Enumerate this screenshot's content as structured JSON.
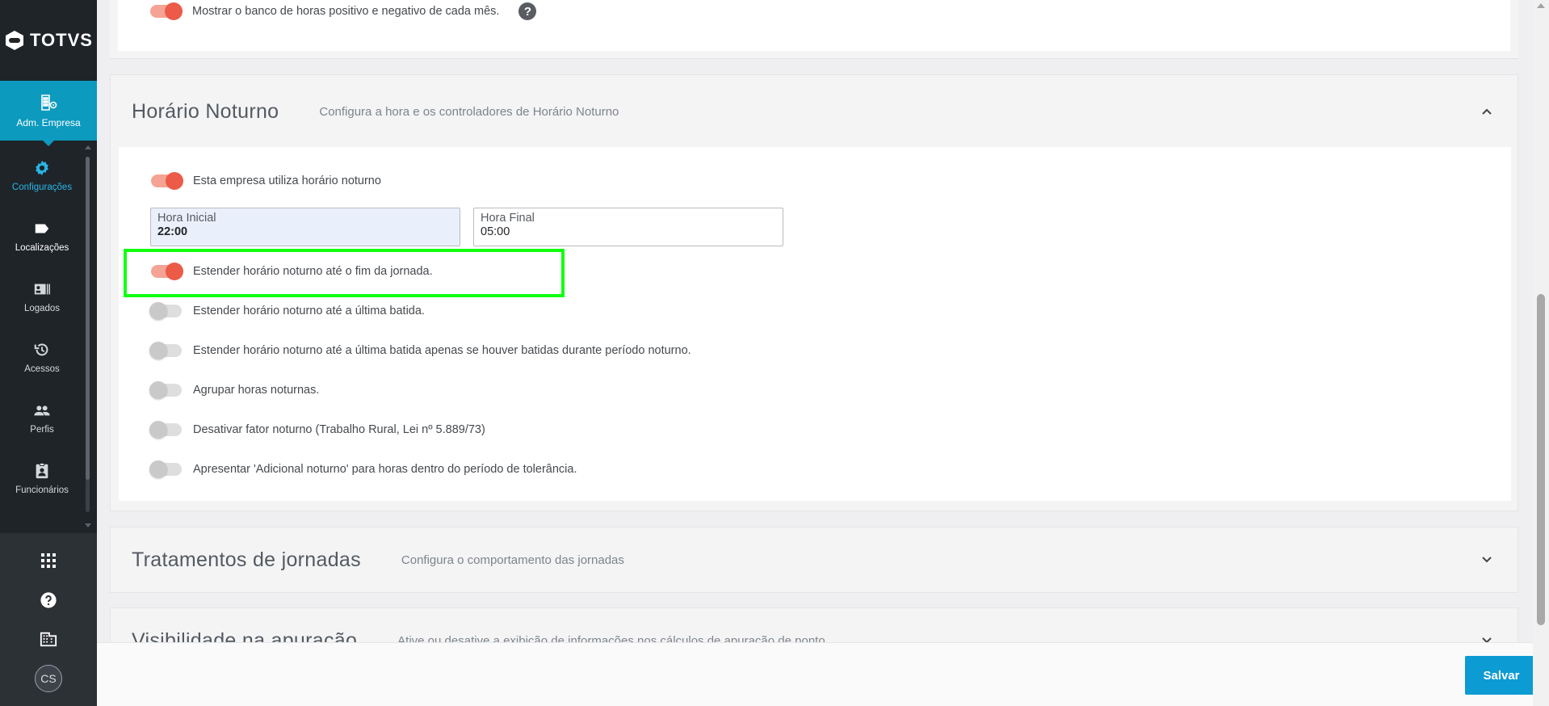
{
  "brand": {
    "name": "TOTVS"
  },
  "sidebar": {
    "module": {
      "label": "Adm. Empresa",
      "icon": "company-admin-icon"
    },
    "items": [
      {
        "label": "Configurações",
        "icon": "gear-icon",
        "active": true
      },
      {
        "label": "Localizações",
        "icon": "tag-icon"
      },
      {
        "label": "Logados",
        "icon": "id-card-icon"
      },
      {
        "label": "Acessos",
        "icon": "history-icon"
      },
      {
        "label": "Perfis",
        "icon": "people-icon"
      },
      {
        "label": "Funcionários",
        "icon": "badge-icon"
      }
    ],
    "bottom": {
      "avatar_initials": "CS"
    }
  },
  "top_option": {
    "label": "Mostrar o banco de horas positivo e negativo de cada mês.",
    "enabled": true
  },
  "sections": [
    {
      "title": "Horário Noturno",
      "subtitle": "Configura a hora e os controladores de Horário Noturno",
      "expanded": true,
      "enable_toggle": {
        "label": "Esta empresa utiliza horário noturno",
        "enabled": true
      },
      "start": {
        "label": "Hora Inicial",
        "value": "22:00"
      },
      "end": {
        "label": "Hora Final",
        "value": "05:00"
      },
      "options": [
        {
          "label": "Estender horário noturno até o fim da jornada.",
          "enabled": true
        },
        {
          "label": "Estender horário noturno até a última batida.",
          "enabled": false
        },
        {
          "label": "Estender horário noturno até a última batida apenas se houver batidas durante período noturno.",
          "enabled": false
        },
        {
          "label": "Agrupar horas noturnas.",
          "enabled": false
        },
        {
          "label": "Desativar fator noturno (Trabalho Rural, Lei nº 5.889/73)",
          "enabled": false
        },
        {
          "label": "Apresentar 'Adicional noturno' para horas dentro do período de tolerância.",
          "enabled": false
        }
      ]
    },
    {
      "title": "Tratamentos de jornadas",
      "subtitle": "Configura o comportamento das jornadas",
      "expanded": false
    },
    {
      "title": "Visibilidade na apuração",
      "subtitle": "Ative ou desative a exibição de informações nos cálculos de apuração de ponto",
      "expanded": false
    }
  ],
  "footer": {
    "save_label": "Salvar"
  },
  "colors": {
    "accent": "#0c9abe",
    "toggle_on": "#ec5a48",
    "highlight": "#12ff12"
  }
}
